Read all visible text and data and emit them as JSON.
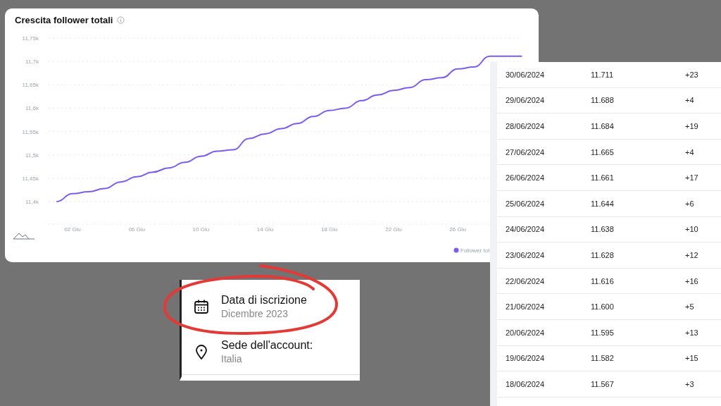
{
  "chart_card": {
    "title": "Crescita follower totali",
    "chart_data": {
      "type": "line",
      "grid": true,
      "x": [
        1,
        2,
        3,
        4,
        5,
        6,
        7,
        8,
        9,
        10,
        11,
        12,
        13,
        14,
        15,
        16,
        17,
        18,
        19,
        20,
        21,
        22,
        23,
        24,
        25,
        26,
        27,
        28,
        29,
        30
      ],
      "series": [
        {
          "name": "Follower tot",
          "color": "#7c5cf0",
          "values": [
            11400,
            11417,
            11421,
            11428,
            11442,
            11453,
            11463,
            11472,
            11484,
            11497,
            11508,
            11511,
            11535,
            11545,
            11556,
            11567,
            11582,
            11595,
            11600,
            11616,
            11628,
            11638,
            11644,
            11661,
            11665,
            11684,
            11688,
            11711,
            11711,
            11711
          ]
        }
      ],
      "xlim": [
        0.5,
        30
      ],
      "ylim": [
        11400,
        11750
      ],
      "xticks": [
        {
          "value": 2,
          "label": "02 Giu"
        },
        {
          "value": 6,
          "label": "06 Giu"
        },
        {
          "value": 10,
          "label": "10 Giu"
        },
        {
          "value": 14,
          "label": "14 Giu"
        },
        {
          "value": 18,
          "label": "18 Giu"
        },
        {
          "value": 22,
          "label": "22 Giu"
        },
        {
          "value": 26,
          "label": "26 Giu"
        }
      ],
      "yticks": [
        {
          "value": 11400,
          "label": "11,4k"
        },
        {
          "value": 11450,
          "label": "11,45k"
        },
        {
          "value": 11500,
          "label": "11,5k"
        },
        {
          "value": 11550,
          "label": "11,55k"
        },
        {
          "value": 11600,
          "label": "11,6k"
        },
        {
          "value": 11650,
          "label": "11,65k"
        },
        {
          "value": 11700,
          "label": "11,7k"
        },
        {
          "value": 11750,
          "label": "11,75k"
        }
      ]
    }
  },
  "table": {
    "rows": [
      {
        "date": "30/06/2024",
        "total": "11.711",
        "change": "+23"
      },
      {
        "date": "29/06/2024",
        "total": "11.688",
        "change": "+4"
      },
      {
        "date": "28/06/2024",
        "total": "11.684",
        "change": "+19"
      },
      {
        "date": "27/06/2024",
        "total": "11.665",
        "change": "+4"
      },
      {
        "date": "26/06/2024",
        "total": "11.661",
        "change": "+17"
      },
      {
        "date": "25/06/2024",
        "total": "11.644",
        "change": "+6"
      },
      {
        "date": "24/06/2024",
        "total": "11.638",
        "change": "+10"
      },
      {
        "date": "23/06/2024",
        "total": "11.628",
        "change": "+12"
      },
      {
        "date": "22/06/2024",
        "total": "11.616",
        "change": "+16"
      },
      {
        "date": "21/06/2024",
        "total": "11.600",
        "change": "+5"
      },
      {
        "date": "20/06/2024",
        "total": "11.595",
        "change": "+13"
      },
      {
        "date": "19/06/2024",
        "total": "11.582",
        "change": "+15"
      },
      {
        "date": "18/06/2024",
        "total": "11.567",
        "change": "+3"
      }
    ]
  },
  "account_info": {
    "items": [
      {
        "kind": "calendar",
        "label": "Data di iscrizione",
        "value": "Dicembre 2023"
      },
      {
        "kind": "location",
        "label": "Sede dell'account:",
        "value": "Italia"
      }
    ]
  }
}
